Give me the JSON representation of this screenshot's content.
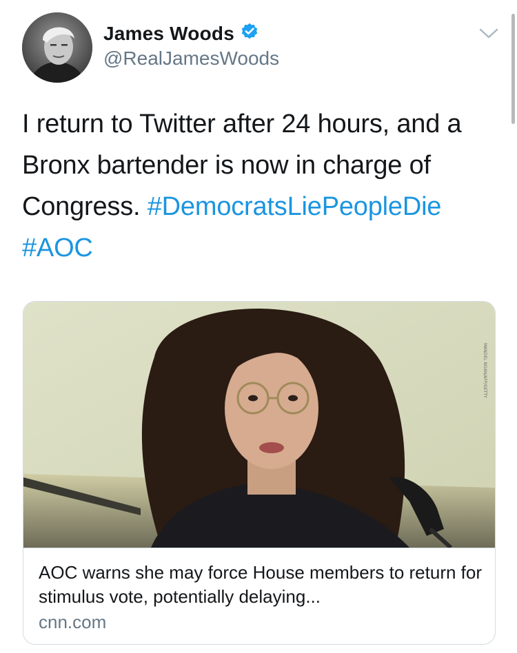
{
  "tweet": {
    "author": {
      "display_name": "James Woods",
      "handle": "@RealJamesWoods",
      "verified": true,
      "verified_icon": "verified-badge-icon",
      "verified_color": "#1da1f2"
    },
    "text_plain": "I return to Twitter after 24 hours, and a Bronx bartender is now in charge of Congress.",
    "hashtags": [
      "#DemocratsLiePeopleDie",
      "#AOC"
    ],
    "menu_icon": "chevron-down-icon"
  },
  "card": {
    "title": "AOC warns she may force House members to return for stimulus vote, potentially delaying...",
    "domain": "cnn.com"
  },
  "colors": {
    "link": "#1b95e0",
    "secondary_text": "#657786",
    "border": "#d3dbe1"
  }
}
